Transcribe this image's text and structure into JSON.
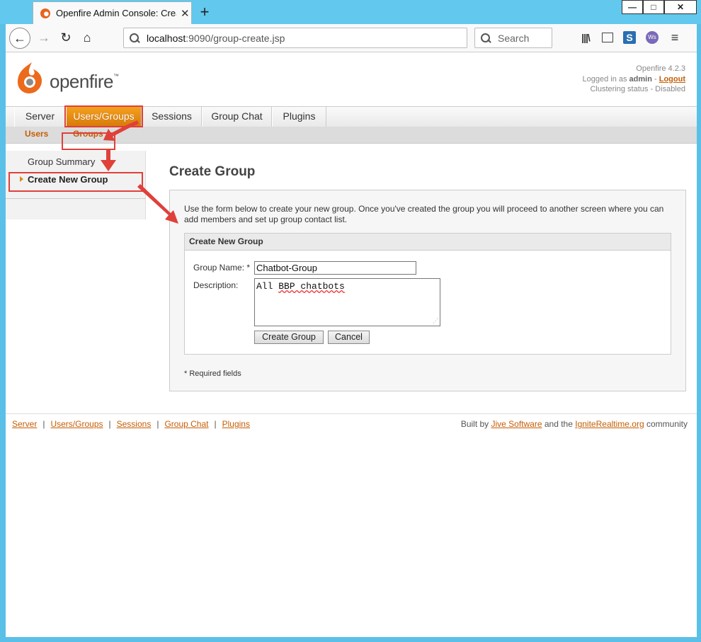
{
  "browser": {
    "tab_title": "Openfire Admin Console: Create Group",
    "tab_close": "✕",
    "new_tab": "+",
    "url_host": "localhost",
    "url_path": ":9090/group-create.jsp",
    "search_placeholder": "Search",
    "window_buttons": {
      "minimize": "—",
      "maximize": "□",
      "close": "✕"
    }
  },
  "header": {
    "logo_text": "openfire",
    "logo_tm": "™",
    "version": "Openfire 4.2.3",
    "logged_in_prefix": "Logged in as ",
    "username": "admin",
    "logout_sep": " - ",
    "logout": "Logout",
    "clustering": "Clustering status - Disabled"
  },
  "main_tabs": [
    "Server",
    "Users/Groups",
    "Sessions",
    "Group Chat",
    "Plugins"
  ],
  "sub_tabs": [
    "Users",
    "Groups"
  ],
  "sidebar": {
    "items": [
      "Group Summary",
      "Create New Group"
    ]
  },
  "content": {
    "title": "Create Group",
    "intro": "Use the form below to create your new group. Once you've created the group you will proceed to another screen where you can add members and set up group contact list.",
    "box_title": "Create New Group",
    "group_name_label": "Group Name: *",
    "group_name_value": "Chatbot-Group",
    "description_label": "Description:",
    "description_prefix": "All ",
    "description_squiggle": "BBP chatbots",
    "create_button": "Create Group",
    "cancel_button": "Cancel",
    "required_note": "* Required fields"
  },
  "footer": {
    "links": [
      "Server",
      "Users/Groups",
      "Sessions",
      "Group Chat",
      "Plugins"
    ],
    "separator": "|",
    "built_by": "Built by ",
    "jive": "Jive Software",
    "and_the": " and the ",
    "ignite": "IgniteRealtime.org",
    "community": " community"
  },
  "colors": {
    "accent": "#e08a14",
    "link": "#c55e05",
    "annotation": "#e0403a"
  }
}
